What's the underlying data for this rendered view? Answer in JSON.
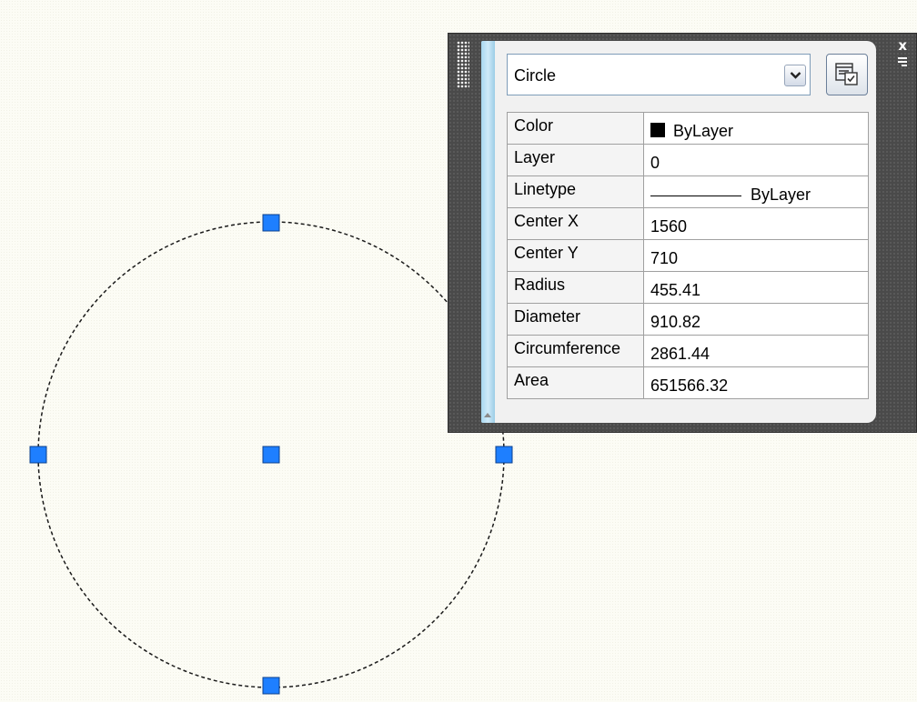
{
  "palette": {
    "close_label": "x",
    "selected_object": "Circle",
    "properties": [
      {
        "name": "Color",
        "value": "ByLayer",
        "swatch_color": "#000000"
      },
      {
        "name": "Layer",
        "value": "0"
      },
      {
        "name": "Linetype",
        "value": "ByLayer"
      },
      {
        "name": "Center X",
        "value": "1560"
      },
      {
        "name": "Center Y",
        "value": "710"
      },
      {
        "name": "Radius",
        "value": "455.41"
      },
      {
        "name": "Diameter",
        "value": "910.82"
      },
      {
        "name": "Circumference",
        "value": "2861.44"
      },
      {
        "name": "Area",
        "value": "651566.32"
      }
    ]
  },
  "drawing": {
    "selected_entity": "circle",
    "linetype": "dashed",
    "grips": [
      "top-quadrant-grip",
      "left-quadrant-grip",
      "center-grip",
      "right-quadrant-grip",
      "bottom-quadrant-grip"
    ],
    "grip_color": "#1e7fff",
    "background_color": "#fcfcf5"
  },
  "icons": {
    "dropdown": "chevron-down-icon",
    "settings": "quick-properties-settings-icon",
    "close": "close-icon",
    "menu": "palette-menu-icon"
  }
}
